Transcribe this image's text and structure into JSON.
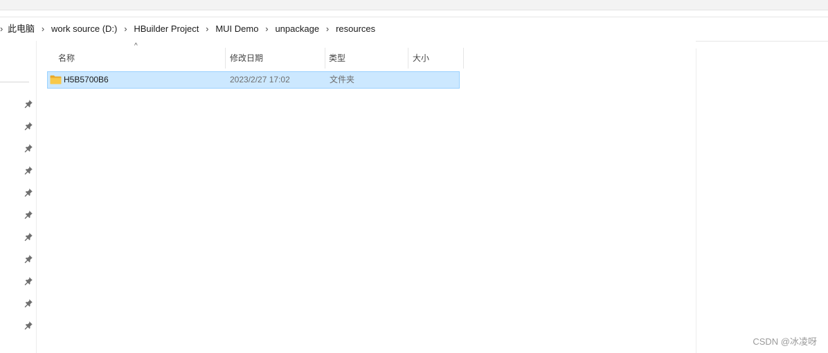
{
  "breadcrumb": [
    "此电脑",
    "work source (D:)",
    "HBuilder Project",
    "MUI Demo",
    "unpackage",
    "resources"
  ],
  "breadcrumb_separator": "›",
  "columns": {
    "name": "名称",
    "date": "修改日期",
    "type": "类型",
    "size": "大小"
  },
  "sort_indicator": "^",
  "files": [
    {
      "name": "H5B5700B6",
      "date": "2023/2/27 17:02",
      "type": "文件夹",
      "size": "",
      "icon": "folder-icon",
      "selected": true
    }
  ],
  "nav_pins": 11,
  "watermark": "CSDN @冰凌呀",
  "colors": {
    "selection_bg": "#cce8ff",
    "selection_border": "#99d1ff",
    "folder": "#f8c94a"
  }
}
